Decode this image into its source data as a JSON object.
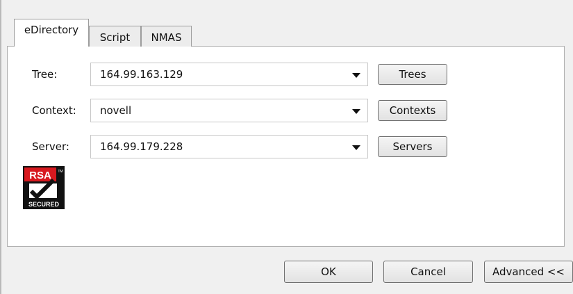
{
  "tabs": [
    {
      "label": "eDirectory",
      "active": true
    },
    {
      "label": "Script",
      "active": false
    },
    {
      "label": "NMAS",
      "active": false
    }
  ],
  "fields": {
    "tree": {
      "label": "Tree:",
      "value": "164.99.163.129",
      "button": "Trees"
    },
    "context": {
      "label": "Context:",
      "value": "novell",
      "button": "Contexts"
    },
    "server": {
      "label": "Server:",
      "value": "164.99.179.228",
      "button": "Servers"
    }
  },
  "logo": {
    "name": "rsa-secured-logo",
    "text_top": "RSA",
    "text_bottom": "SECURED",
    "tm": "TM"
  },
  "footer": {
    "ok": "OK",
    "cancel": "Cancel",
    "advanced": "Advanced <<"
  },
  "colors": {
    "window_bg": "#f0f0f0",
    "panel_bg": "#ffffff",
    "logo_red": "#d8191f",
    "logo_black": "#111111"
  }
}
